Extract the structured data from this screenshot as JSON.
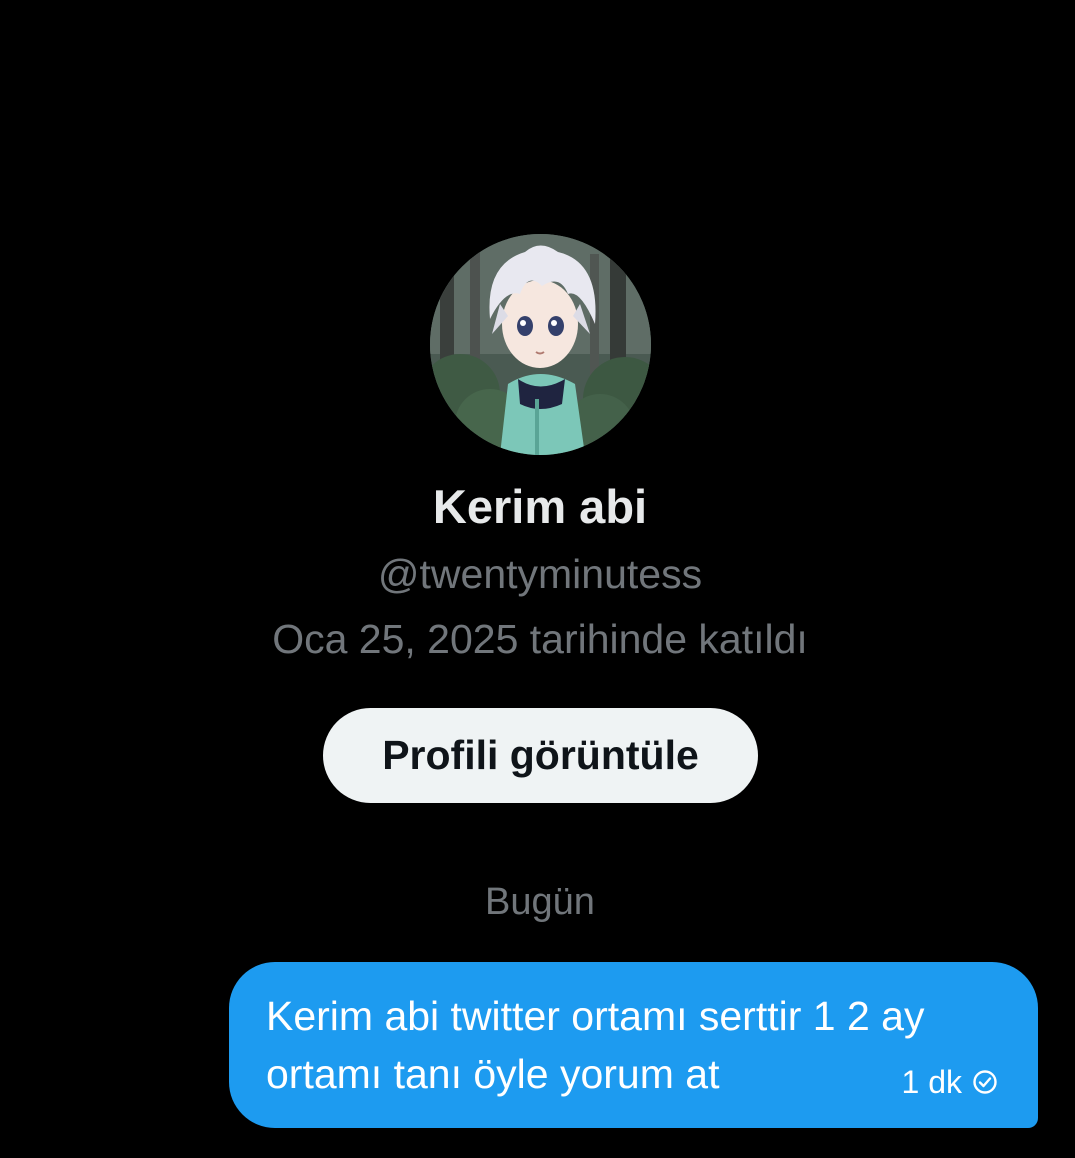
{
  "profile": {
    "name": "Kerim abi",
    "handle": "@twentyminutess",
    "joined": "Oca 25, 2025 tarihinde katıldı",
    "view_profile_label": "Profili görüntüle",
    "avatar_icon": "anime-avatar-image"
  },
  "conversation": {
    "day_divider": "Bugün",
    "messages": [
      {
        "text": "Kerim abi twitter ortamı serttir 1 2 ay ortamı tanı öyle yorum at",
        "time": "1 dk",
        "status_icon": "sent-check-icon"
      }
    ]
  },
  "colors": {
    "background": "#000000",
    "primary_text": "#e7e9ea",
    "secondary_text": "#71767b",
    "bubble": "#1d9bf0",
    "button_bg": "#eff3f4",
    "button_text": "#0f1419"
  }
}
